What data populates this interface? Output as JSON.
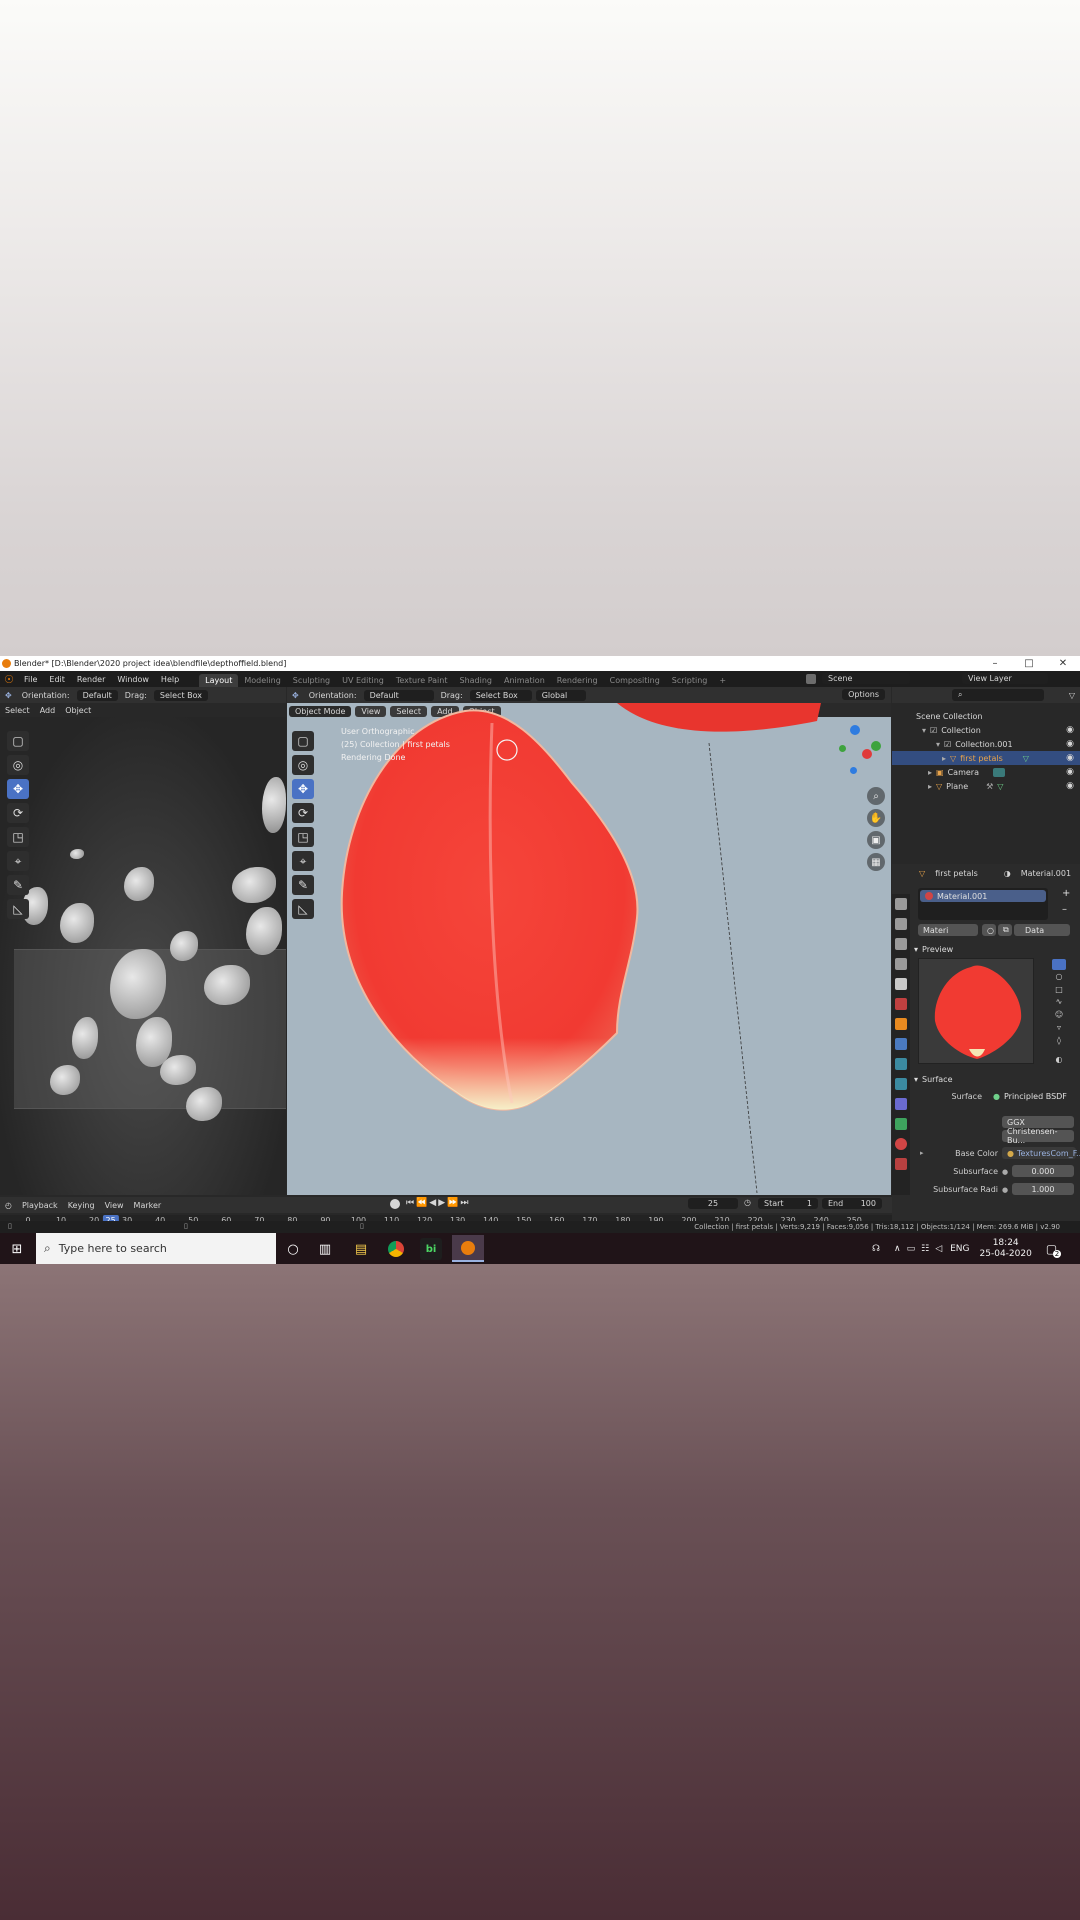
{
  "window": {
    "title": "Blender* [D:\\Blender\\2020 project idea\\blendfile\\depthoffield.blend]",
    "minimize": "–",
    "maximize": "□",
    "close": "✕"
  },
  "menu": {
    "items": [
      "File",
      "Edit",
      "Render",
      "Window",
      "Help"
    ],
    "workspaces": [
      "Layout",
      "Modeling",
      "Sculpting",
      "UV Editing",
      "Texture Paint",
      "Shading",
      "Animation",
      "Rendering",
      "Compositing",
      "Scripting"
    ],
    "active_workspace": "Layout",
    "add_workspace": "+",
    "scene_label": "Scene",
    "view_layer_label": "View Layer"
  },
  "left_header": {
    "orientation_label": "Orientation:",
    "orientation_value": "Default",
    "drag_label": "Drag:",
    "drag_value": "Select Box",
    "menus": [
      "Select",
      "Add",
      "Object"
    ]
  },
  "viewport_header": {
    "orientation_label": "Orientation:",
    "orientation_value": "Default",
    "drag_label": "Drag:",
    "drag_value": "Select Box",
    "transform": "Global",
    "options": "Options",
    "mode": "Object Mode",
    "menus": [
      "View",
      "Select",
      "Add",
      "Object"
    ]
  },
  "viewport": {
    "info_line1": "User Orthographic",
    "info_line2": "(25) Collection | first petals",
    "info_line3": "Rendering Done"
  },
  "outliner": {
    "search_icon": "search-icon",
    "rows": [
      {
        "label": "Scene Collection",
        "indent": 0
      },
      {
        "label": "Collection",
        "indent": 1
      },
      {
        "label": "Collection.001",
        "indent": 2
      },
      {
        "label": "first petals",
        "indent": 3
      },
      {
        "label": "Camera",
        "indent": 2
      },
      {
        "label": "Plane",
        "indent": 2
      }
    ],
    "selected_row": "first petals"
  },
  "properties": {
    "object_name": "first petals",
    "material_name": "Material.001",
    "slot_name": "Material.001",
    "material_field": "Materi",
    "data_dropdown": "Data",
    "preview_label": "Preview",
    "surface_section": "Surface",
    "surface_label": "Surface",
    "surface_value": "Principled BSDF",
    "distribution": "GGX",
    "subsurface_method": "Christensen-Bu...",
    "base_color_label": "Base Color",
    "base_color_value": "TexturesCom_F...",
    "subsurface_label": "Subsurface",
    "subsurface_value": "0.000",
    "subsurface_radius_label": "Subsurface Radi",
    "subsurface_radius_value": "1.000"
  },
  "timeline": {
    "menus": [
      "Playback",
      "Keying",
      "View",
      "Marker"
    ],
    "current_frame": "25",
    "start_label": "Start",
    "start_value": "1",
    "end_label": "End",
    "end_value": "100",
    "ticks": [
      "0",
      "10",
      "20",
      "30",
      "40",
      "50",
      "60",
      "70",
      "80",
      "90",
      "100",
      "110",
      "120",
      "130",
      "140",
      "150",
      "160",
      "170",
      "180",
      "190",
      "200",
      "210",
      "220",
      "230",
      "240",
      "250"
    ],
    "playhead_label": "25"
  },
  "status": {
    "text": "Collection | first petals | Verts:9,219 | Faces:9,056 | Tris:18,112 | Objects:1/124 | Mem: 269.6 MiB | v2.90"
  },
  "taskbar": {
    "search_placeholder": "Type here to search",
    "language": "ENG",
    "time": "18:24",
    "date": "25-04-2020",
    "notification_count": "2",
    "bi_label": "bi"
  },
  "colors": {
    "accent_blue": "#4a72c4",
    "petal_red": "#f13a32",
    "viewport_bg": "#a7b6c1",
    "blender_orange": "#e87d0d"
  }
}
